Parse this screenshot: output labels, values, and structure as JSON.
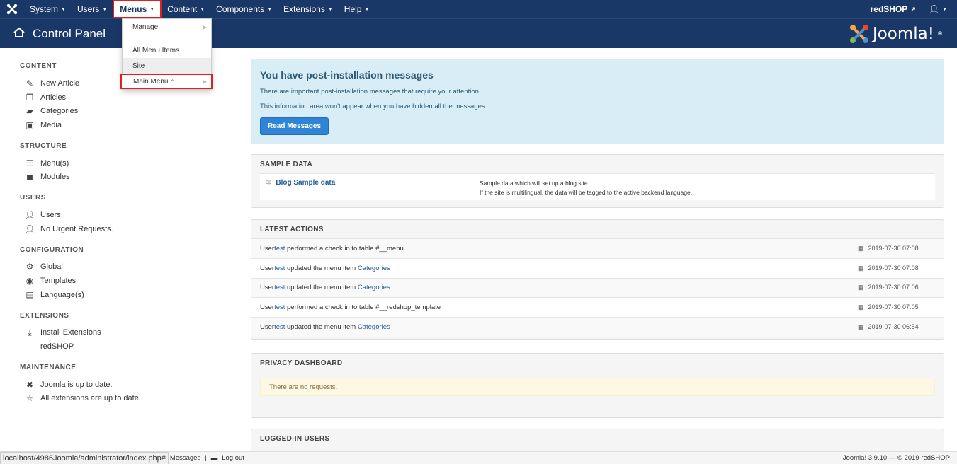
{
  "topnav": {
    "menus": [
      {
        "label": "System"
      },
      {
        "label": "Users"
      },
      {
        "label": "Menus"
      },
      {
        "label": "Content"
      },
      {
        "label": "Components"
      },
      {
        "label": "Extensions"
      },
      {
        "label": "Help"
      }
    ],
    "site_link": "redSHOP"
  },
  "header": {
    "title": "Control Panel",
    "brand": "Joomla!"
  },
  "dropdown": {
    "manage": "Manage",
    "all_items": "All Menu Items",
    "site": "Site",
    "main_menu": "Main Menu"
  },
  "sidebar": {
    "content": {
      "title": "CONTENT",
      "items": [
        "New Article",
        "Articles",
        "Categories",
        "Media"
      ]
    },
    "structure": {
      "title": "STRUCTURE",
      "items": [
        "Menu(s)",
        "Modules"
      ]
    },
    "users": {
      "title": "USERS",
      "items": [
        "Users",
        "No Urgent Requests."
      ]
    },
    "configuration": {
      "title": "CONFIGURATION",
      "items": [
        "Global",
        "Templates",
        "Language(s)"
      ]
    },
    "extensions": {
      "title": "EXTENSIONS",
      "items": [
        "Install Extensions",
        "redSHOP"
      ]
    },
    "maintenance": {
      "title": "MAINTENANCE",
      "items": [
        "Joomla is up to date.",
        "All extensions are up to date."
      ]
    }
  },
  "alert": {
    "title": "You have post-installation messages",
    "line1": "There are important post-installation messages that require your attention.",
    "line2": "This information area won't appear when you have hidden all the messages.",
    "button": "Read Messages"
  },
  "sample": {
    "title": "SAMPLE DATA",
    "link": "Blog Sample data",
    "desc1": "Sample data which will set up a blog site.",
    "desc2": "If the site is multilingual, the data will be tagged to the active backend language."
  },
  "latest": {
    "title": "LATEST ACTIONS",
    "rows": [
      {
        "pre": "User ",
        "user": "test",
        "mid": " performed a check in to table #__menu",
        "link": "",
        "date": "2019-07-30 07:08"
      },
      {
        "pre": "User ",
        "user": "test",
        "mid": " updated the menu item ",
        "link": "Categories",
        "date": "2019-07-30 07:08"
      },
      {
        "pre": "User ",
        "user": "test",
        "mid": " updated the menu item ",
        "link": "Categories",
        "date": "2019-07-30 07:06"
      },
      {
        "pre": "User ",
        "user": "test",
        "mid": " performed a check in to table #__redshop_template",
        "link": "",
        "date": "2019-07-30 07:05"
      },
      {
        "pre": "User ",
        "user": "test",
        "mid": " updated the menu item ",
        "link": "Categories",
        "date": "2019-07-30 06:54"
      }
    ]
  },
  "privacy": {
    "title": "PRIVACY DASHBOARD",
    "message": "There are no requests."
  },
  "logged": {
    "title": "LOGGED-IN USERS"
  },
  "statusbar": {
    "url": "localhost/4986Joomla/administrator/index.php#",
    "messages": "Messages",
    "logout": "Log out",
    "version": "Joomla! 3.9.10 — © 2019 redSHOP"
  }
}
